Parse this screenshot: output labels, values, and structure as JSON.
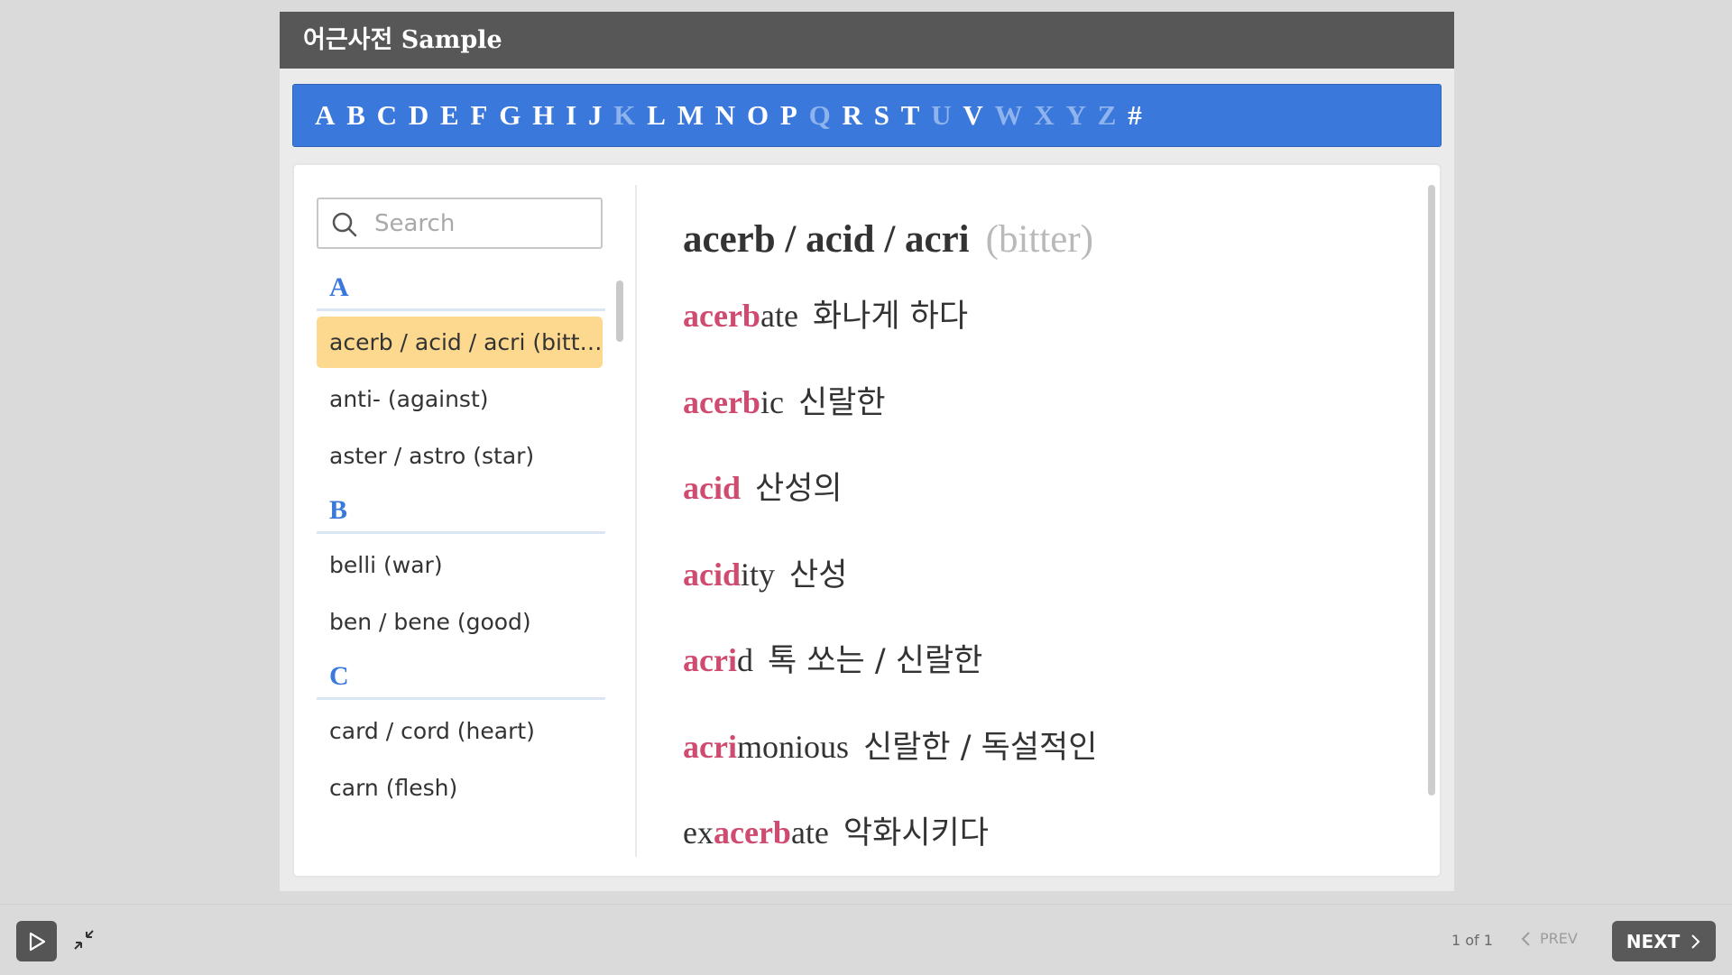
{
  "app": {
    "title": "어근사전 Sample"
  },
  "alphabet": [
    {
      "letter": "A",
      "enabled": true
    },
    {
      "letter": "B",
      "enabled": true
    },
    {
      "letter": "C",
      "enabled": true
    },
    {
      "letter": "D",
      "enabled": true
    },
    {
      "letter": "E",
      "enabled": true
    },
    {
      "letter": "F",
      "enabled": true
    },
    {
      "letter": "G",
      "enabled": true
    },
    {
      "letter": "H",
      "enabled": true
    },
    {
      "letter": "I",
      "enabled": true
    },
    {
      "letter": "J",
      "enabled": true
    },
    {
      "letter": "K",
      "enabled": false
    },
    {
      "letter": "L",
      "enabled": true
    },
    {
      "letter": "M",
      "enabled": true
    },
    {
      "letter": "N",
      "enabled": true
    },
    {
      "letter": "O",
      "enabled": true
    },
    {
      "letter": "P",
      "enabled": true
    },
    {
      "letter": "Q",
      "enabled": false
    },
    {
      "letter": "R",
      "enabled": true
    },
    {
      "letter": "S",
      "enabled": true
    },
    {
      "letter": "T",
      "enabled": true
    },
    {
      "letter": "U",
      "enabled": false
    },
    {
      "letter": "V",
      "enabled": true
    },
    {
      "letter": "W",
      "enabled": false
    },
    {
      "letter": "X",
      "enabled": false
    },
    {
      "letter": "Y",
      "enabled": false
    },
    {
      "letter": "Z",
      "enabled": false
    },
    {
      "letter": "#",
      "enabled": true
    }
  ],
  "search": {
    "placeholder": "Search",
    "value": ""
  },
  "root_list": [
    {
      "heading": "A",
      "items": [
        {
          "label": "acerb / acid / acri  (bitter)",
          "active": true
        },
        {
          "label": "anti-  (against)",
          "active": false
        },
        {
          "label": "aster / astro  (star)",
          "active": false
        }
      ]
    },
    {
      "heading": "B",
      "items": [
        {
          "label": "belli  (war)",
          "active": false
        },
        {
          "label": "ben / bene  (good)",
          "active": false
        }
      ]
    },
    {
      "heading": "C",
      "items": [
        {
          "label": "card / cord  (heart)",
          "active": false
        },
        {
          "label": "carn  (flesh)",
          "active": false
        }
      ]
    }
  ],
  "entry": {
    "root": "acerb / acid / acri",
    "meaning": "(bitter)",
    "words": [
      {
        "pre": "",
        "hl": "acerb",
        "post": "ate",
        "def": "화나게 하다"
      },
      {
        "pre": "",
        "hl": "acerb",
        "post": "ic",
        "def": "신랄한"
      },
      {
        "pre": "",
        "hl": "acid",
        "post": "",
        "def": "산성의"
      },
      {
        "pre": "",
        "hl": "acid",
        "post": "ity",
        "def": "산성"
      },
      {
        "pre": "",
        "hl": "acri",
        "post": "d",
        "def": "톡 쏘는 / 신랄한"
      },
      {
        "pre": "",
        "hl": "acri",
        "post": "monious",
        "def": "신랄한 / 독설적인"
      },
      {
        "pre": "ex",
        "hl": "acerb",
        "post": "ate",
        "def": "악화시키다"
      }
    ]
  },
  "footer": {
    "page_count": "1 of 1",
    "prev_label": "PREV",
    "next_label": "NEXT"
  },
  "icons": {
    "search": "search-icon",
    "play": "play-icon",
    "collapse": "collapse-icon",
    "prev": "chevron-left-icon",
    "next": "chevron-right-icon"
  },
  "colors": {
    "accent_blue": "#3a78dc",
    "highlight_pink": "#cf4b70",
    "active_item": "#fdd98f",
    "title_bar": "#575757"
  }
}
